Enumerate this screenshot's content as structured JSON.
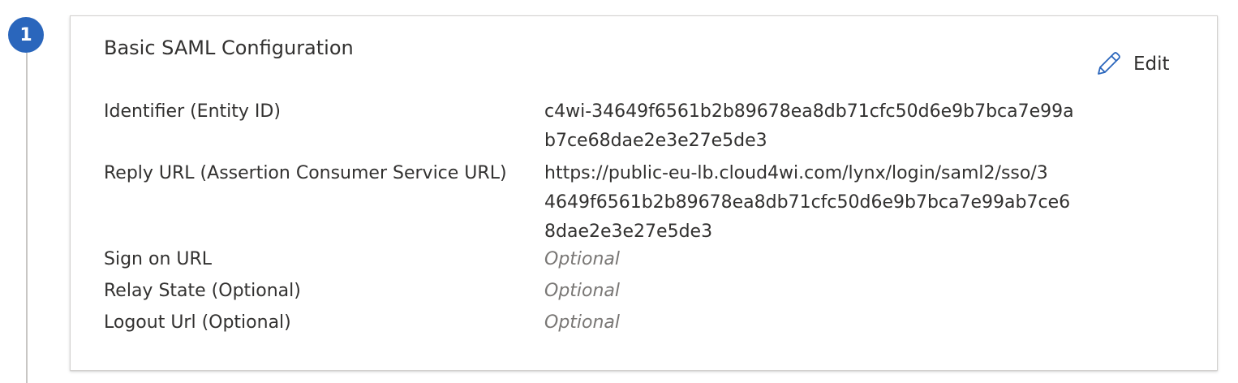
{
  "step": {
    "number": "1"
  },
  "card": {
    "title": "Basic SAML Configuration",
    "edit_label": "Edit"
  },
  "fields": [
    {
      "label": "Identifier (Entity ID)",
      "value_lines": [
        "c4wi-34649f6561b2b89678ea8db71cfc50d6e9b7bca7e99a",
        "b7ce68dae2e3e27e5de3"
      ]
    },
    {
      "label": "Reply URL (Assertion Consumer Service URL)",
      "value_lines": [
        "https://public-eu-lb.cloud4wi.com/lynx/login/saml2/sso/3",
        "4649f6561b2b89678ea8db71cfc50d6e9b7bca7e99ab7ce6",
        "8dae2e3e27e5de3"
      ]
    },
    {
      "label": "Sign on URL",
      "value": "Optional"
    },
    {
      "label": "Relay State (Optional)",
      "value": "Optional"
    },
    {
      "label": "Logout Url (Optional)",
      "value": "Optional"
    }
  ],
  "colors": {
    "step_badge": "#2a66bc",
    "text_primary": "#323130",
    "text_placeholder": "#797775",
    "edit_icon": "#2a66bc"
  },
  "icons": {
    "edit": "pencil-icon"
  }
}
